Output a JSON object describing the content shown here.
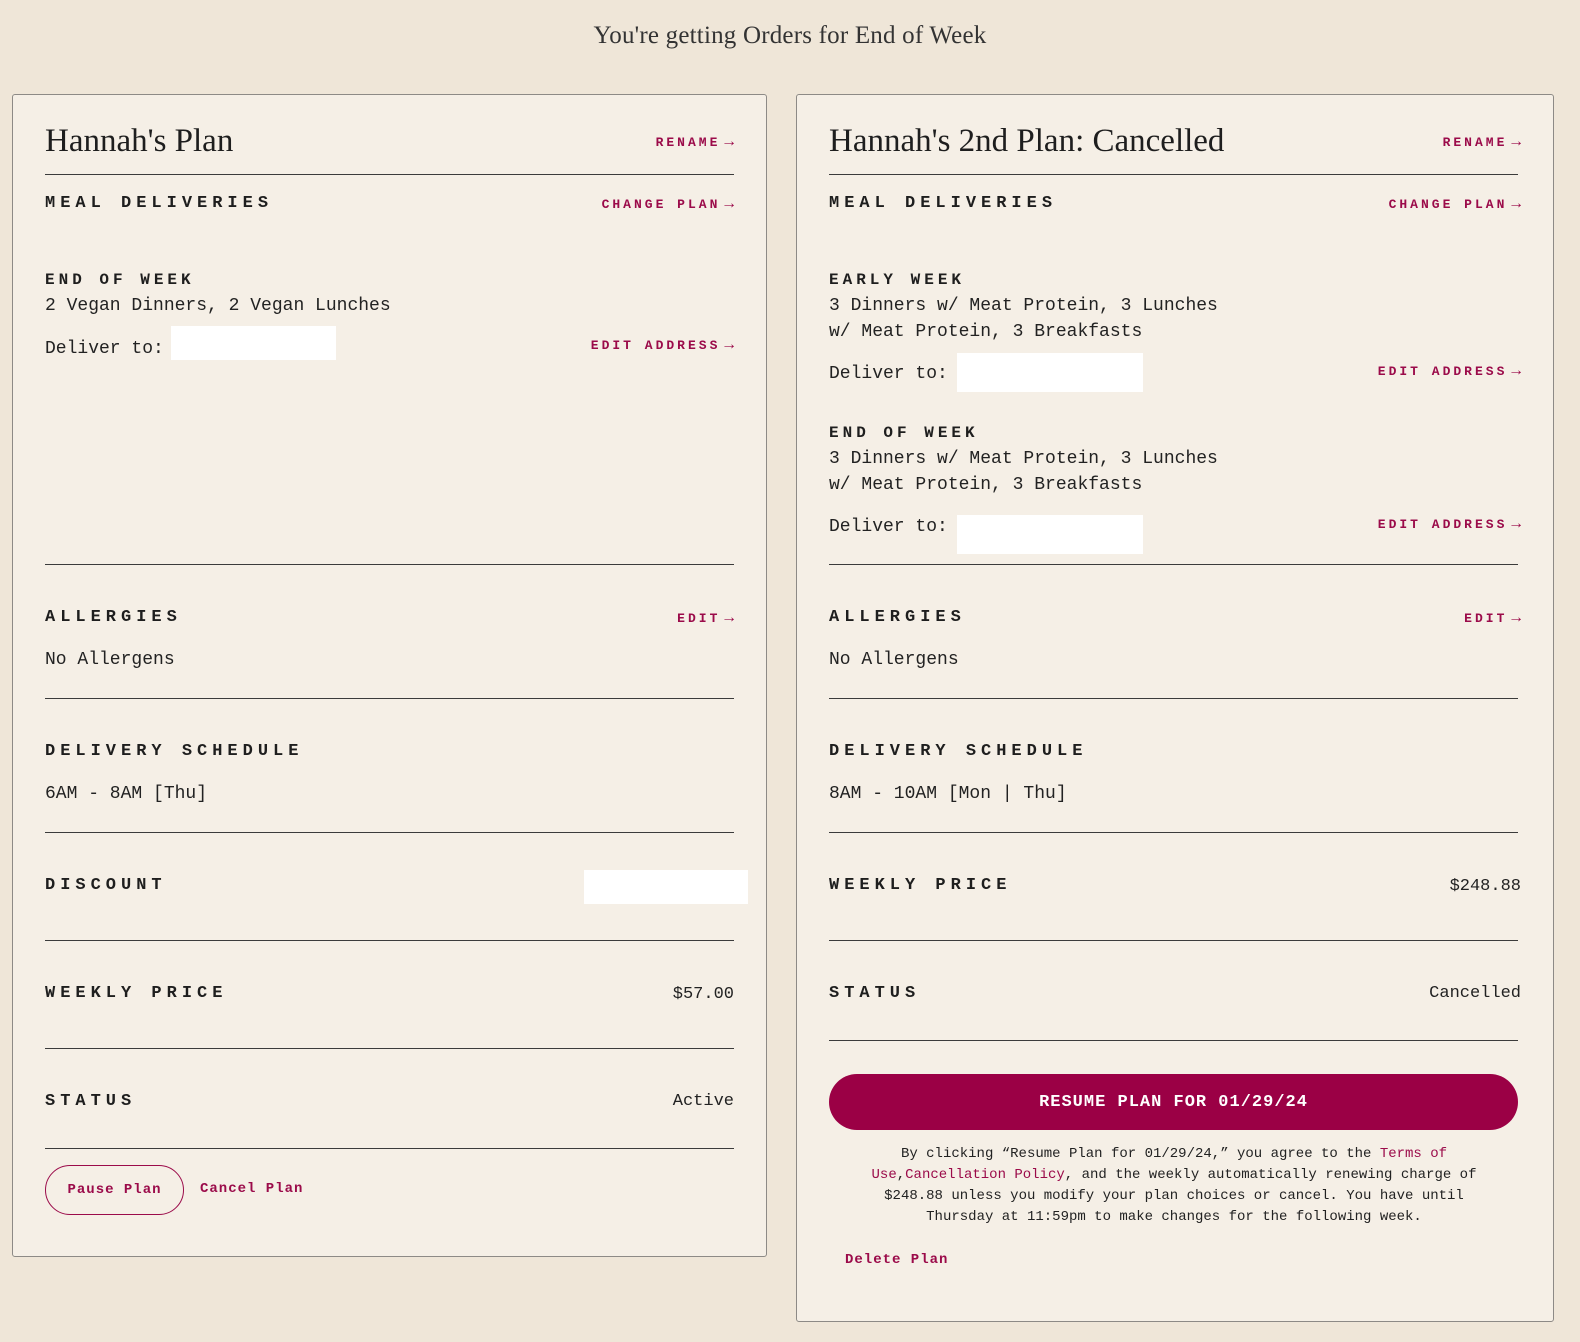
{
  "page": {
    "title": "You're getting Orders for End of Week"
  },
  "plans": [
    {
      "name": "Hannah's Plan",
      "rename_label": "RENAME",
      "meal_deliveries": {
        "title": "MEAL DELIVERIES",
        "change_plan_label": "CHANGE PLAN",
        "deliveries": [
          {
            "day": "END OF WEEK",
            "description": "2 Vegan Dinners, 2 Vegan Lunches",
            "deliver_to_label": "Deliver to:",
            "edit_address_label": "EDIT ADDRESS"
          }
        ]
      },
      "allergies": {
        "title": "ALLERGIES",
        "edit_label": "EDIT",
        "value": "No Allergens"
      },
      "delivery_schedule": {
        "title": "DELIVERY SCHEDULE",
        "value": "6AM - 8AM [Thu]"
      },
      "discount": {
        "title": "DISCOUNT"
      },
      "weekly_price": {
        "title": "WEEKLY PRICE",
        "value": "$57.00"
      },
      "status": {
        "title": "STATUS",
        "value": "Active"
      },
      "actions": {
        "pause_label": "Pause Plan",
        "cancel_label": "Cancel Plan"
      }
    },
    {
      "name": "Hannah's 2nd Plan: Cancelled",
      "rename_label": "RENAME",
      "meal_deliveries": {
        "title": "MEAL DELIVERIES",
        "change_plan_label": "CHANGE PLAN",
        "deliveries": [
          {
            "day": "EARLY WEEK",
            "description_line1": "3 Dinners w/ Meat Protein, 3 Lunches",
            "description_line2": "w/ Meat Protein, 3 Breakfasts",
            "deliver_to_label": "Deliver to:",
            "edit_address_label": "EDIT ADDRESS"
          },
          {
            "day": "END OF WEEK",
            "description_line1": "3 Dinners w/ Meat Protein, 3 Lunches",
            "description_line2": "w/ Meat Protein, 3 Breakfasts",
            "deliver_to_label": "Deliver to:",
            "edit_address_label": "EDIT ADDRESS"
          }
        ]
      },
      "allergies": {
        "title": "ALLERGIES",
        "edit_label": "EDIT",
        "value": "No Allergens"
      },
      "delivery_schedule": {
        "title": "DELIVERY SCHEDULE",
        "value": "8AM - 10AM [Mon | Thu]"
      },
      "weekly_price": {
        "title": "WEEKLY PRICE",
        "value": "$248.88"
      },
      "status": {
        "title": "STATUS",
        "value": "Cancelled"
      },
      "resume_button_label": "RESUME PLAN FOR 01/29/24",
      "legal": {
        "part1": "By clicking “Resume Plan for 01/29/24,” you agree to the ",
        "terms_link": "Terms of Use",
        "separator": ",",
        "cancellation_link": "Cancellation Policy",
        "part2": ", and the weekly automatically renewing charge of $248.88 unless you modify your plan choices or cancel. You have until Thursday at 11:59pm to make changes for the following week."
      },
      "delete_label": "Delete Plan"
    }
  ],
  "icons": {
    "arrow": "arrow-right-icon"
  },
  "colors": {
    "accent": "#9b0b4a",
    "primary_button": "#9b0045",
    "background": "#efe6d8",
    "card": "#f5efe6"
  }
}
